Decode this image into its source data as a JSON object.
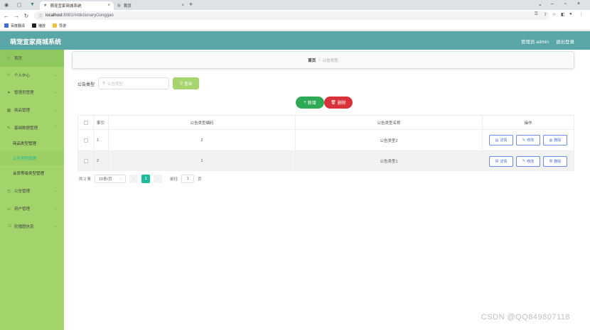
{
  "browser": {
    "tabs": [
      {
        "title": "萌宠宜家商城系统",
        "active": true
      },
      {
        "title": "首页",
        "active": false
      }
    ],
    "url_host": "localhost",
    "url_path": ":8081/#/dictionaryGonggao",
    "bookmarks": [
      "百度翻译",
      "播放",
      "导游"
    ]
  },
  "header": {
    "title": "萌宠宜家商城系统",
    "user_label": "管理员 admin",
    "logout_label": "退出登录",
    "color": "#5aa6a6"
  },
  "sidebar": {
    "color": "#a3d46b",
    "items": [
      {
        "label": "首页",
        "icon": "home-icon"
      },
      {
        "label": "个人中心",
        "icon": "user-icon"
      },
      {
        "label": "管理员管理",
        "icon": "send-icon"
      },
      {
        "label": "商品管理",
        "icon": "grid-icon"
      },
      {
        "label": "基础数据管理",
        "icon": "edit-icon"
      },
      {
        "label": "公告管理",
        "icon": "clock-icon"
      },
      {
        "label": "用户管理",
        "icon": "folder-icon"
      },
      {
        "label": "轮播图信息",
        "icon": "shuffle-icon"
      }
    ],
    "subitems": [
      {
        "label": "商品类型管理",
        "active": false
      },
      {
        "label": "公告类型管理",
        "active": true
      },
      {
        "label": "会员等级类型管理",
        "active": false
      }
    ]
  },
  "breadcrumb": {
    "home": "首页",
    "separator": "/",
    "current": "公告类型"
  },
  "search": {
    "label": "公告类型",
    "placeholder": "公告类型",
    "button": "查询"
  },
  "actions": {
    "add": "新增",
    "delete": "删除"
  },
  "table": {
    "headers": [
      "索引",
      "公告类型编码",
      "公告类型名称",
      "操作"
    ],
    "rows": [
      {
        "index": "1",
        "code": "2",
        "name": "公告类型2"
      },
      {
        "index": "2",
        "code": "1",
        "name": "公告类型1"
      }
    ],
    "ops": {
      "detail": "详情",
      "edit": "修改",
      "delete": "删除"
    }
  },
  "pagination": {
    "total": "共 2 条",
    "page_size": "10条/页",
    "current_page": "1",
    "goto_label": "前往",
    "goto_value": "1",
    "page_suffix": "页"
  },
  "watermark": "CSDN @QQ849807118"
}
